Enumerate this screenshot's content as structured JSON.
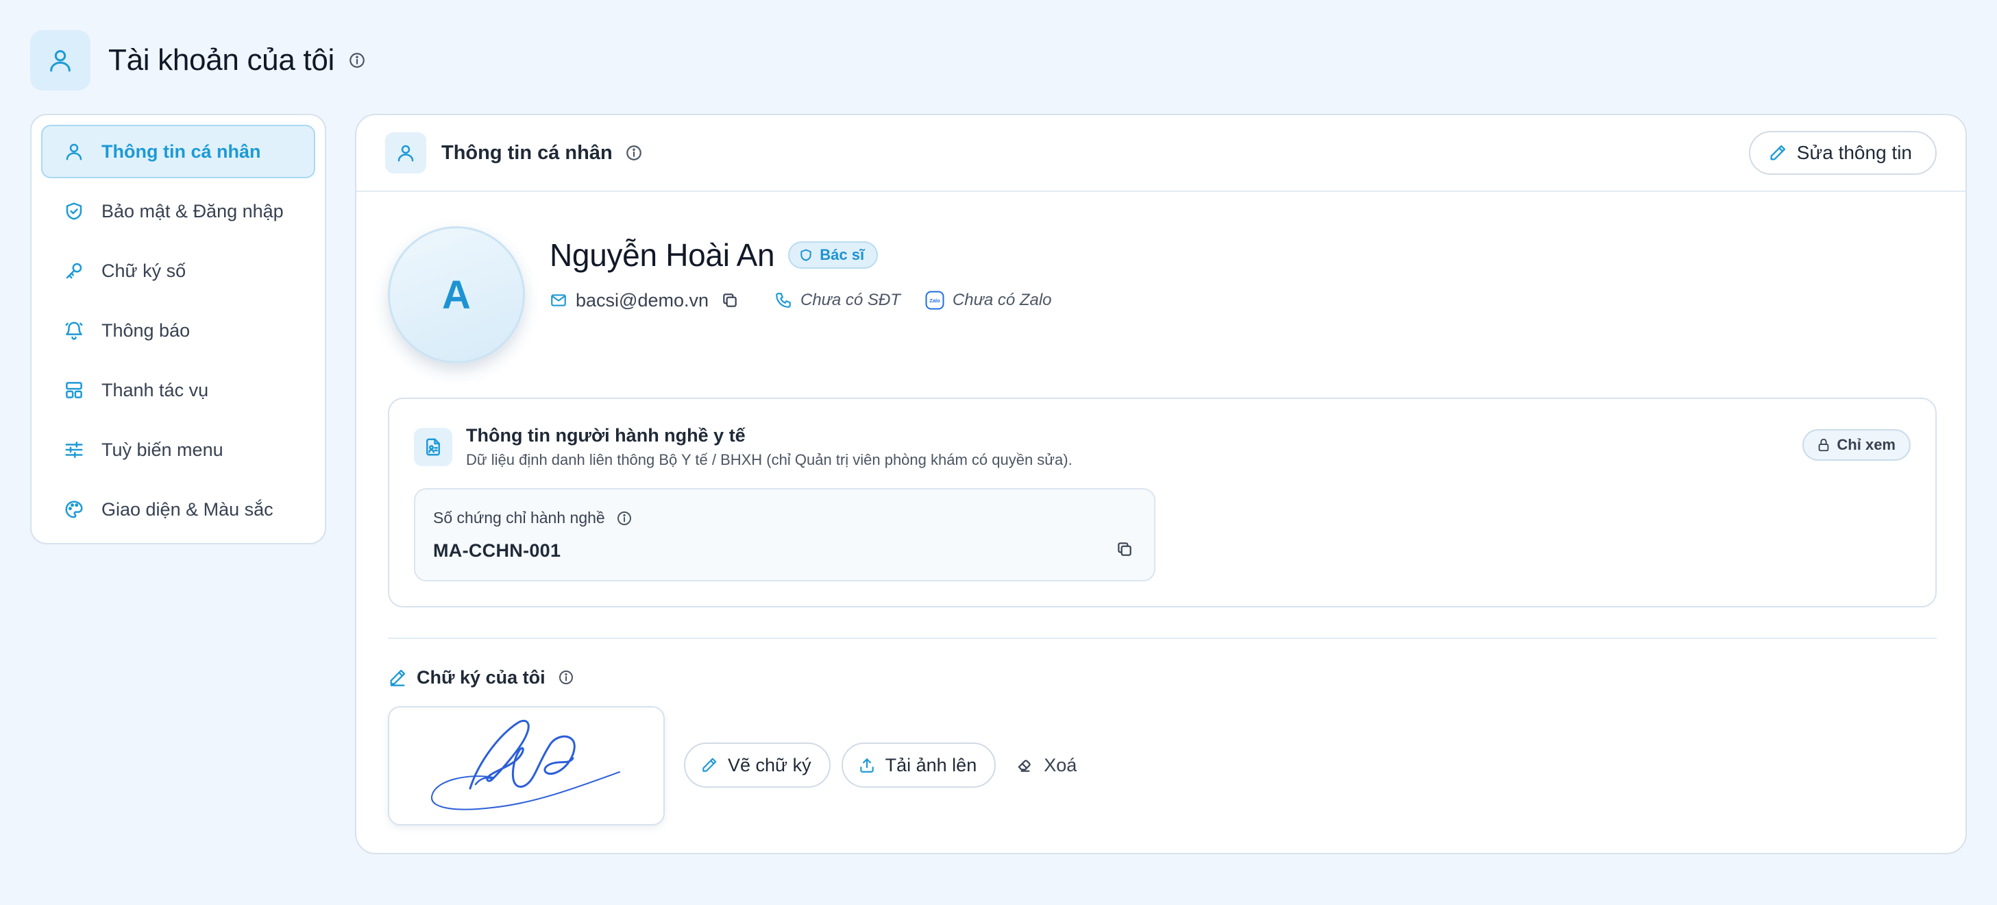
{
  "page": {
    "title": "Tài khoản của tôi"
  },
  "sidebar": {
    "items": [
      {
        "label": "Thông tin cá nhân",
        "icon": "user-icon",
        "active": true
      },
      {
        "label": "Bảo mật & Đăng nhập",
        "icon": "shield-check-icon"
      },
      {
        "label": "Chữ ký số",
        "icon": "key-icon"
      },
      {
        "label": "Thông báo",
        "icon": "bell-icon"
      },
      {
        "label": "Thanh tác vụ",
        "icon": "layout-icon"
      },
      {
        "label": "Tuỳ biến menu",
        "icon": "sliders-icon"
      },
      {
        "label": "Giao diện & Màu sắc",
        "icon": "palette-icon"
      }
    ]
  },
  "card": {
    "title": "Thông tin cá nhân",
    "edit_label": "Sửa thông tin"
  },
  "profile": {
    "avatar_letter": "A",
    "name": "Nguyễn Hoài An",
    "role": "Bác sĩ",
    "email": "bacsi@demo.vn",
    "phone": "Chưa có SĐT",
    "zalo": "Chưa có Zalo",
    "zalo_icon_text": "Zalo"
  },
  "practitioner": {
    "title": "Thông tin người hành nghề y tế",
    "subtitle": "Dữ liệu định danh liên thông Bộ Y tế / BHXH (chỉ Quản trị viên phòng khám có quyền sửa).",
    "readonly_label": "Chỉ xem",
    "cert_label": "Số chứng chỉ hành nghề",
    "cert_value": "MA-CCHN-001"
  },
  "signature": {
    "title": "Chữ ký của tôi",
    "draw_label": "Vẽ chữ ký",
    "upload_label": "Tải ảnh lên",
    "delete_label": "Xoá"
  },
  "colors": {
    "accent": "#1d9ad6",
    "background": "#eff6fd",
    "signature_ink": "#2b5fd9"
  }
}
